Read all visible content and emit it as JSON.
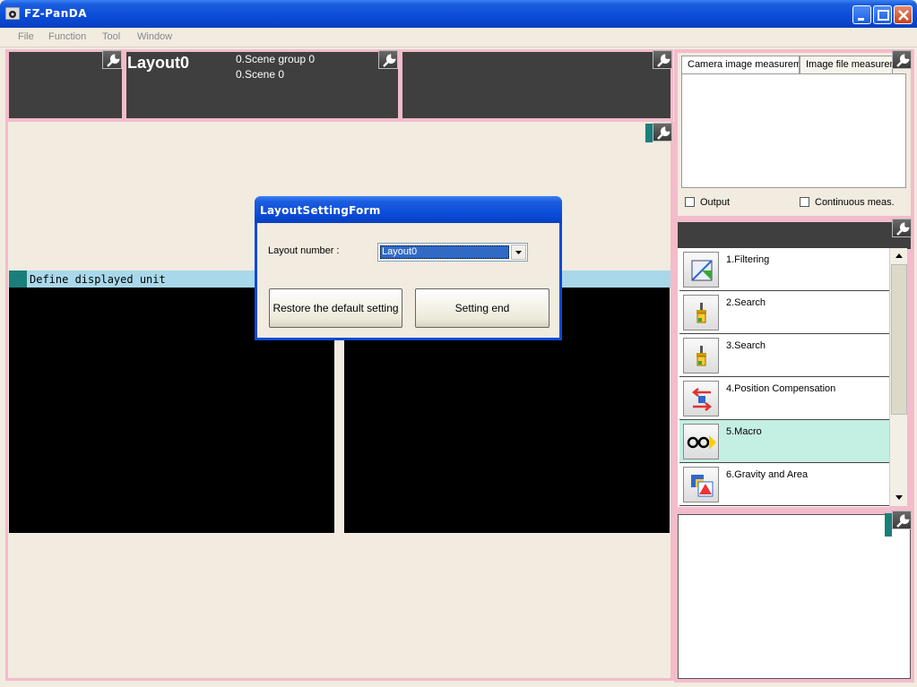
{
  "window": {
    "title": "FZ-PanDA",
    "accent": "#0a4bd6"
  },
  "menu": {
    "items": [
      "File",
      "Function",
      "Tool",
      "Window"
    ]
  },
  "info_panel": {
    "layout_name": "Layout0",
    "scene_group": "0.Scene group 0",
    "scene": "0.Scene 0"
  },
  "display": {
    "unit_label": "Define displayed unit"
  },
  "measure_panel": {
    "tabs": [
      "Camera image measurement",
      "Image file measurement"
    ],
    "output_label": "Output",
    "continuous_label": "Continuous meas."
  },
  "flow": {
    "items": [
      {
        "label": "1.Filtering",
        "icon": "filter-icon"
      },
      {
        "label": "2.Search",
        "icon": "search-tool-icon"
      },
      {
        "label": "3.Search",
        "icon": "search-tool-icon"
      },
      {
        "label": "4.Position Compensation",
        "icon": "position-compensation-icon"
      },
      {
        "label": "5.Macro",
        "icon": "macro-icon",
        "selected": true
      },
      {
        "label": "6.Gravity and Area",
        "icon": "gravity-area-icon"
      }
    ]
  },
  "dialog": {
    "title": "LayoutSettingForm",
    "layout_number_label": "Layout number :",
    "layout_number_value": "Layout0",
    "restore_button": "Restore the default setting",
    "end_button": "Setting end"
  },
  "colors": {
    "pink_frame": "#f3bccb",
    "dark_panel": "#3f3f3f",
    "teal_marker": "#1a7f7a",
    "unit_bar": "#a9d8ea",
    "selected_item": "#c4efe3"
  }
}
